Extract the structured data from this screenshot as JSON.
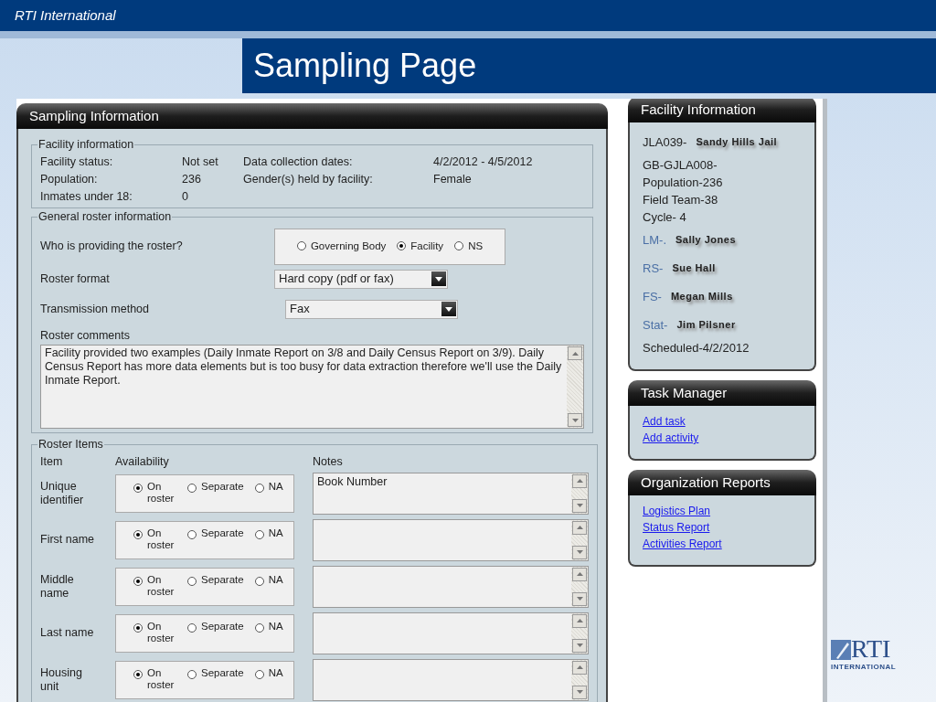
{
  "slide_header": {
    "org": "RTI International",
    "title": "Sampling Page"
  },
  "sampling": {
    "title": "Sampling Information",
    "facility_info": {
      "legend": "Facility information",
      "left_fields": [
        {
          "label": "Facility status:",
          "value": "Not set"
        },
        {
          "label": "Population:",
          "value": "236"
        },
        {
          "label": "Inmates under 18:",
          "value": "0"
        }
      ],
      "right_fields": [
        {
          "label": "Data collection dates:",
          "value": "4/2/2012 - 4/5/2012"
        },
        {
          "label": "Gender(s) held by facility:",
          "value": "Female"
        }
      ]
    },
    "roster_info": {
      "legend": "General roster information",
      "provider": {
        "label": "Who is providing the roster?",
        "options": [
          {
            "label": "Governing Body",
            "selected": false
          },
          {
            "label": "Facility",
            "selected": true
          },
          {
            "label": "NS",
            "selected": false
          }
        ]
      },
      "format": {
        "label": "Roster format",
        "value": "Hard copy (pdf or fax)"
      },
      "transmission": {
        "label": "Transmission method",
        "value": "Fax"
      },
      "comments": {
        "label": "Roster comments",
        "value": "Facility provided two examples (Daily Inmate Report on 3/8 and Daily Census Report on 3/9). Daily Census Report has more data elements but is too busy for data extraction therefore we'll use the Daily Inmate Report."
      }
    },
    "roster_items": {
      "legend": "Roster Items",
      "columns": [
        "Item",
        "Availability",
        "Notes"
      ],
      "rows": [
        {
          "item": "Unique identifier",
          "notes": "Book Number",
          "options": [
            {
              "label": "On roster",
              "selected": true
            },
            {
              "label": "Separate",
              "selected": false
            },
            {
              "label": "NA",
              "selected": false
            }
          ]
        },
        {
          "item": "First name",
          "options": [
            {
              "label": "On roster",
              "selected": true
            },
            {
              "label": "Separate",
              "selected": false
            },
            {
              "label": "NA",
              "selected": false
            }
          ]
        },
        {
          "item": "Middle name",
          "options": [
            {
              "label": "On roster",
              "selected": true
            },
            {
              "label": "Separate",
              "selected": false
            },
            {
              "label": "NA",
              "selected": false
            }
          ]
        },
        {
          "item": "Last name",
          "options": [
            {
              "label": "On roster",
              "selected": true
            },
            {
              "label": "Separate",
              "selected": false
            },
            {
              "label": "NA",
              "selected": false
            }
          ]
        },
        {
          "item": "Housing unit",
          "options": [
            {
              "label": "On roster",
              "selected": true
            },
            {
              "label": "Separate",
              "selected": false
            },
            {
              "label": "NA",
              "selected": false
            }
          ]
        }
      ]
    }
  },
  "facility_card": {
    "title": "Facility Information",
    "lines": [
      {
        "kind": "code",
        "text": "JLA039-",
        "name": "Sandy Hills Jail"
      },
      {
        "kind": "text",
        "text": "GB-GJLA008-"
      },
      {
        "kind": "text",
        "text": "Population-236"
      },
      {
        "kind": "text",
        "text": "Field Team-38"
      },
      {
        "kind": "text",
        "text": "Cycle- 4"
      },
      {
        "kind": "role",
        "text": "LM-.",
        "name": "Sally Jones"
      },
      {
        "kind": "role",
        "text": "RS-",
        "name": "Sue Hall"
      },
      {
        "kind": "role",
        "text": "FS-",
        "name": "Megan Mills"
      },
      {
        "kind": "role",
        "text": "Stat-",
        "name": "Jim Pilsner"
      },
      {
        "kind": "text",
        "text": "Scheduled-4/2/2012"
      }
    ]
  },
  "task_card": {
    "title": "Task Manager",
    "links": [
      "Add task",
      "Add activity"
    ]
  },
  "reports_card": {
    "title": "Organization Reports",
    "links": [
      "Logistics Plan",
      "Status Report",
      "Activities Report"
    ]
  },
  "logo": {
    "letters": "RTI",
    "subtitle": "INTERNATIONAL"
  }
}
